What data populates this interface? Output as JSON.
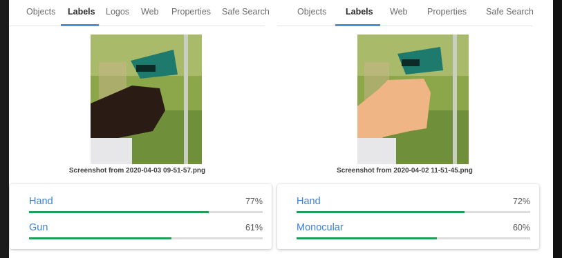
{
  "colors": {
    "accent": "#4a90d9",
    "label_link": "#3b82d4",
    "bar_fill": "#1e9e57",
    "bar_track": "#dcdcdc"
  },
  "left_panel": {
    "tabs": [
      {
        "label": "Objects",
        "active": false
      },
      {
        "label": "Labels",
        "active": true
      },
      {
        "label": "Logos",
        "active": false
      },
      {
        "label": "Web",
        "active": false
      },
      {
        "label": "Properties",
        "active": false
      },
      {
        "label": "Safe Search",
        "active": false
      }
    ],
    "image": {
      "icon": "photo-dark-hand-thermometer"
    },
    "filename": "Screenshot from 2020-04-03 09-51-57.png",
    "labels": [
      {
        "name": "Hand",
        "percent_text": "77%",
        "score": 0.77
      },
      {
        "name": "Gun",
        "percent_text": "61%",
        "score": 0.61
      }
    ]
  },
  "right_panel": {
    "tabs": [
      {
        "label": "Objects",
        "active": false
      },
      {
        "label": "Labels",
        "active": true
      },
      {
        "label": "Web",
        "active": false
      },
      {
        "label": "Properties",
        "active": false
      },
      {
        "label": "Safe Search",
        "active": false
      }
    ],
    "image": {
      "icon": "photo-light-hand-thermometer"
    },
    "filename": "Screenshot from 2020-04-02 11-51-45.png",
    "labels": [
      {
        "name": "Hand",
        "percent_text": "72%",
        "score": 0.72
      },
      {
        "name": "Monocular",
        "percent_text": "60%",
        "score": 0.6
      }
    ]
  }
}
